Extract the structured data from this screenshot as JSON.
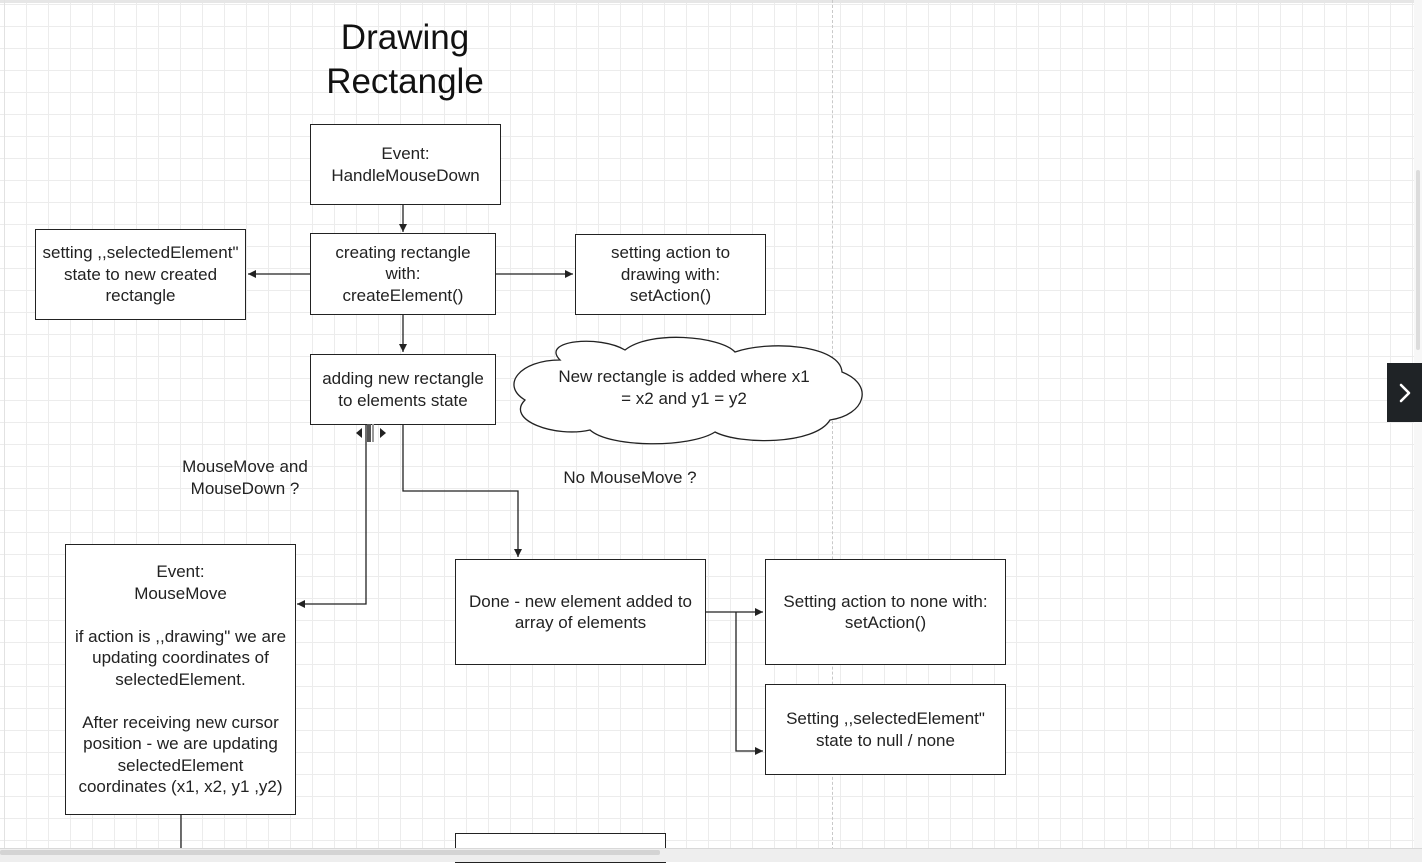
{
  "diagram": {
    "title": "Drawing\nRectangle",
    "nodes": {
      "mousedown": "Event:\nHandleMouseDown",
      "create": "creating rectangle\nwith:\ncreateElement()",
      "selected_state": "setting ,,selectedElement\"\nstate to new created\nrectangle",
      "set_action": "setting action to\ndrawing with:\nsetAction()",
      "add_state": "adding new rectangle\nto elements state",
      "cloud_note": "New rectangle is added where x1\n= x2 and y1 = y2",
      "mousemove": "Event:\nMouseMove\n\nif action is ,,drawing\" we are\nupdating coordinates of\nselectedElement.\n\nAfter receiving new cursor\nposition - we are updating\nselectedElement\ncoordinates (x1, x2, y1 ,y2)",
      "done": "Done - new element added to\narray of elements",
      "action_none": "Setting action to none with:\nsetAction()",
      "selected_null": "Setting ,,selectedElement\"\nstate to null / none",
      "next": ""
    },
    "edge_labels": {
      "mousemove_and_down": "MouseMove and\nMouseDown ?",
      "no_mousemove": "No MouseMove ?"
    }
  },
  "ui": {
    "side_toggle_icon": "chevron-right-icon",
    "resize_icon": "resize-handle-icon"
  }
}
